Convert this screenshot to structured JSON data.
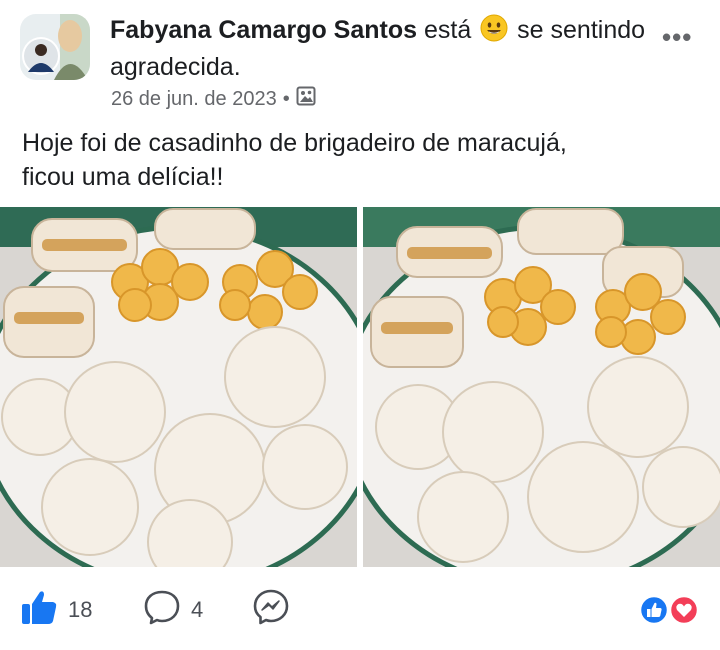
{
  "post": {
    "author": "Fabyana Camargo Santos",
    "feeling_prefix": "está",
    "feeling_emoji": "smiling-face-emoji",
    "feeling_suffix": "se sentindo agradecida.",
    "date": "26 de jun. de 2023",
    "separator": "•",
    "audience_icon": "photo-album-icon",
    "more_label": "•••",
    "text": "Hoje foi de casadinho de brigadeiro de maracujá,\nficou uma delícia!!"
  },
  "photos": [
    {
      "description_icon": "cookie-sandwich-photo"
    },
    {
      "description_icon": "cookie-sandwich-photo"
    }
  ],
  "actions": {
    "like_icon": "thumbs-up-icon",
    "like_count": "18",
    "comment_icon": "comment-bubble-icon",
    "comment_count": "4",
    "share_icon": "messenger-icon"
  },
  "reactions": {
    "icons": [
      "like-reaction-icon",
      "love-reaction-icon"
    ],
    "like_color": "#1877f2",
    "love_color": "#f33e58"
  },
  "colors": {
    "accent": "#1877f2",
    "text": "#1c1e21",
    "muted": "#65676b"
  }
}
